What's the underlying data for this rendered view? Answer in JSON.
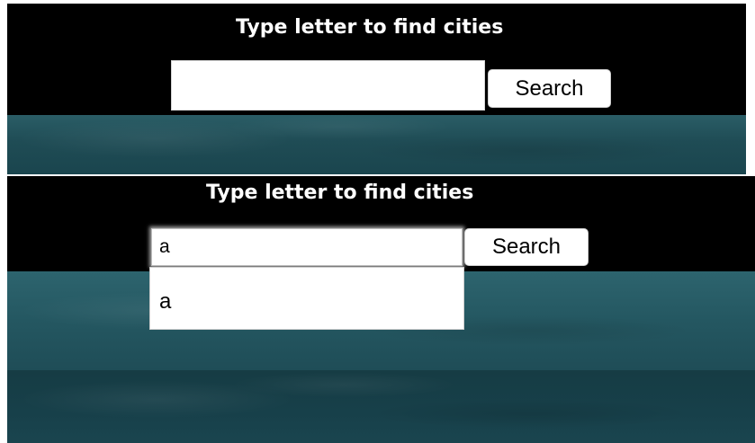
{
  "panels": [
    {
      "title": "Type letter to find cities",
      "search_input": {
        "value": "",
        "placeholder": ""
      },
      "search_button_label": "Search"
    },
    {
      "title": "Type letter to find cities",
      "search_input": {
        "value": "a",
        "placeholder": ""
      },
      "search_button_label": "Search",
      "suggestions": [
        "a"
      ]
    }
  ],
  "colors": {
    "header_bg": "#000000",
    "teal_bg": "#245761",
    "teal_dark_bg": "#163c44",
    "title_text": "#ffffff"
  }
}
